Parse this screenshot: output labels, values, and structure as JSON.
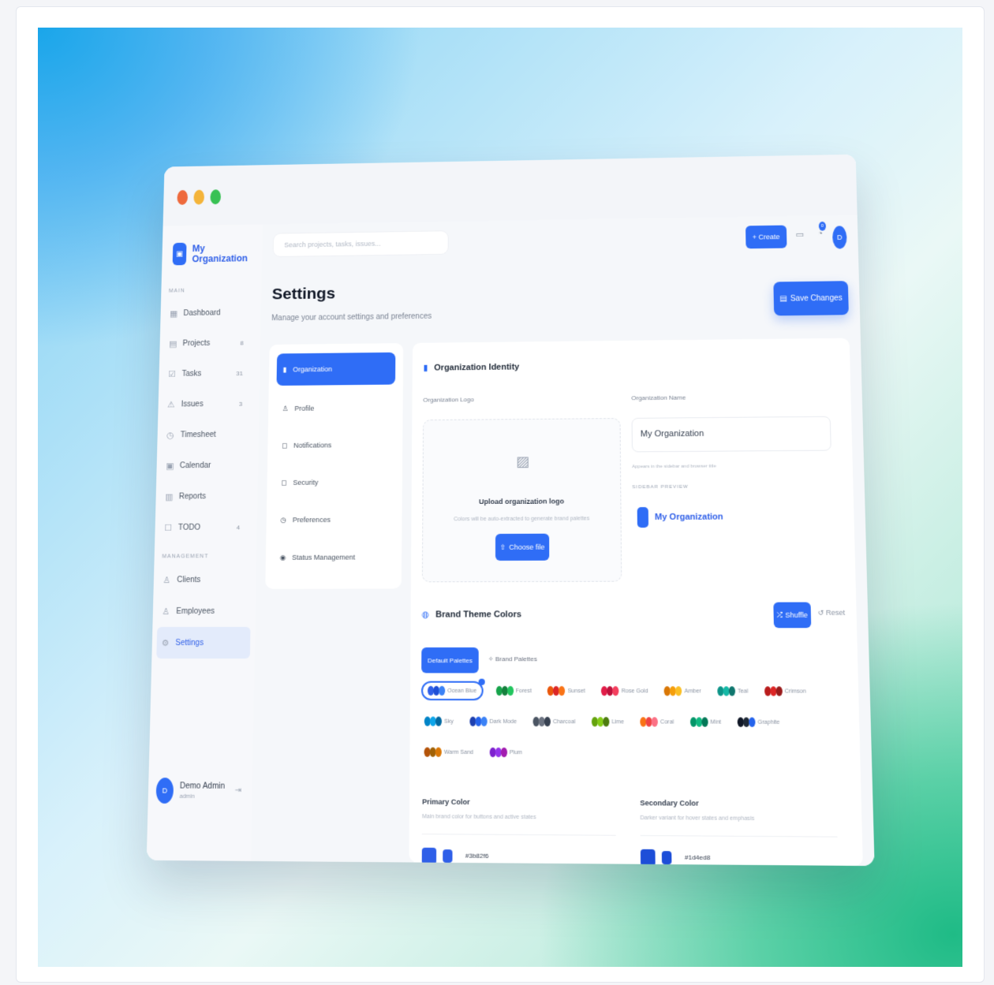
{
  "sidebar": {
    "brand": "My Organization",
    "sections": {
      "main": "MAIN",
      "management": "MANAGEMENT"
    },
    "main_items": [
      {
        "label": "Dashboard",
        "count": ""
      },
      {
        "label": "Projects",
        "count": "8"
      },
      {
        "label": "Tasks",
        "count": "31"
      },
      {
        "label": "Issues",
        "count": "3"
      },
      {
        "label": "Timesheet",
        "count": ""
      },
      {
        "label": "Calendar",
        "count": ""
      },
      {
        "label": "Reports",
        "count": ""
      },
      {
        "label": "TODO",
        "count": "4"
      }
    ],
    "management_items": [
      {
        "label": "Clients"
      },
      {
        "label": "Employees"
      },
      {
        "label": "Settings"
      }
    ],
    "user": {
      "initial": "D",
      "name": "Demo Admin",
      "role": "admin"
    }
  },
  "topbar": {
    "search_placeholder": "Search projects, tasks, issues...",
    "create_label": "+ Create",
    "notification_count": "0",
    "avatar_initial": "D"
  },
  "page": {
    "title": "Settings",
    "subtitle": "Manage your account settings and preferences",
    "save_label": "Save Changes"
  },
  "settings_tabs": [
    {
      "label": "Organization"
    },
    {
      "label": "Profile"
    },
    {
      "label": "Notifications"
    },
    {
      "label": "Security"
    },
    {
      "label": "Preferences"
    },
    {
      "label": "Status Management"
    }
  ],
  "identity": {
    "heading": "Organization Identity",
    "logo_label": "Organization Logo",
    "upload_title": "Upload organization logo",
    "upload_sub": "Colors will be auto-extracted to generate brand palettes",
    "choose_label": "Choose file",
    "name_label": "Organization Name",
    "name_value": "My Organization",
    "name_help": "Appears in the sidebar and browser title",
    "preview_label": "SIDEBAR PREVIEW",
    "preview_name": "My Organization"
  },
  "theme": {
    "heading": "Brand Theme Colors",
    "shuffle_label": "Shuffle",
    "reset_label": "Reset",
    "tab_default": "Default Palettes",
    "tab_brand": "Brand Palettes",
    "palettes": [
      {
        "name": "Ocean Blue",
        "colors": [
          "#2f5fe8",
          "#1f4fd6",
          "#3b82f6"
        ]
      },
      {
        "name": "Forest",
        "colors": [
          "#16a34a",
          "#15803d",
          "#22c55e"
        ]
      },
      {
        "name": "Sunset",
        "colors": [
          "#ea580c",
          "#dc2626",
          "#f97316"
        ]
      },
      {
        "name": "Rose Gold",
        "colors": [
          "#e11d48",
          "#be123c",
          "#f43f5e"
        ]
      },
      {
        "name": "Amber",
        "colors": [
          "#d97706",
          "#f59e0b",
          "#fbbf24"
        ]
      },
      {
        "name": "Teal",
        "colors": [
          "#0d9488",
          "#14b8a6",
          "#0f766e"
        ]
      },
      {
        "name": "Crimson",
        "colors": [
          "#b91c1c",
          "#dc2626",
          "#991b1b"
        ]
      },
      {
        "name": "Sky",
        "colors": [
          "#0284c7",
          "#0ea5e9",
          "#0369a1"
        ]
      },
      {
        "name": "Dark Mode",
        "colors": [
          "#1e40af",
          "#2563eb",
          "#3b82f6"
        ]
      },
      {
        "name": "Charcoal",
        "colors": [
          "#4b5563",
          "#6b7280",
          "#374151"
        ]
      },
      {
        "name": "Lime",
        "colors": [
          "#65a30d",
          "#84cc16",
          "#4d7c0f"
        ]
      },
      {
        "name": "Coral",
        "colors": [
          "#f97316",
          "#ef4444",
          "#fb7185"
        ]
      },
      {
        "name": "Mint",
        "colors": [
          "#059669",
          "#10b981",
          "#047857"
        ]
      },
      {
        "name": "Graphite",
        "colors": [
          "#111827",
          "#1f2937",
          "#2563eb"
        ]
      },
      {
        "name": "Warm Sand",
        "colors": [
          "#b45309",
          "#a16207",
          "#d97706"
        ]
      },
      {
        "name": "Plum",
        "colors": [
          "#7e22ce",
          "#9333ea",
          "#a21caf"
        ]
      }
    ],
    "primary": {
      "title": "Primary Color",
      "sub": "Main brand color for buttons and active states",
      "hex": "#3b82f6",
      "color": "#2f5fe8"
    },
    "secondary": {
      "title": "Secondary Color",
      "sub": "Darker variant for hover states and emphasis",
      "hex": "#1d4ed8",
      "color": "#1d4ed8"
    }
  },
  "colors": {
    "accent": "#2f6df6"
  }
}
